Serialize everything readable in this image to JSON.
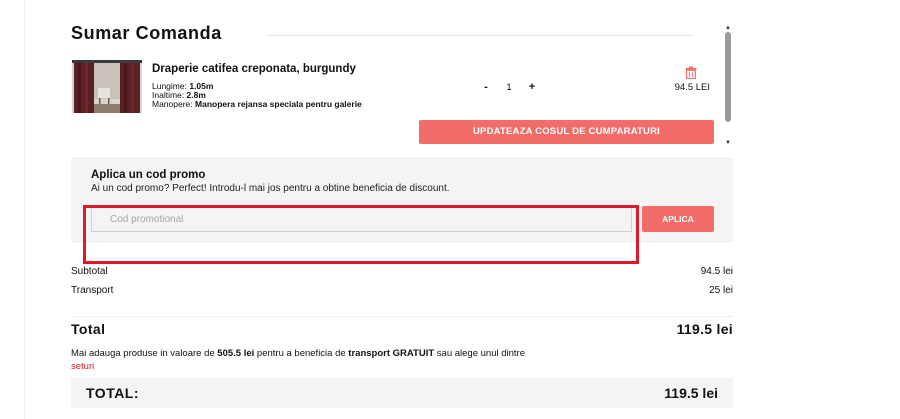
{
  "summary": {
    "title": "Sumar Comanda"
  },
  "cart_item": {
    "image_icon": "curtain-product-photo",
    "name": "Draperie catifea creponata, burgundy",
    "length_label": "Lungime:",
    "length_value": "1.05m",
    "height_label": "Inaltime:",
    "height_value": "2.8m",
    "finish_label": "Manopere:",
    "finish_value": "Manopera rejansa speciala pentru galerie",
    "qty_minus": "-",
    "qty_value": "1",
    "qty_plus": "+",
    "remove_icon": "trash-icon",
    "price": "94.5 LEI"
  },
  "update_cart_label": "UPDATEAZA COSUL DE CUMPARATURI",
  "promo": {
    "title": "Aplica un cod promo",
    "description": "Ai un cod promo? Perfect! Introdu-l mai jos pentru a obtine beneficia de discount.",
    "input_placeholder": "Cod promotional",
    "input_value": "",
    "apply_label": "APLICA"
  },
  "totals": {
    "subtotal_label": "Subtotal",
    "subtotal_value": "94.5 lei",
    "transport_label": "Transport",
    "transport_value": "25 lei",
    "total_label": "Total",
    "total_value": "119.5 lei",
    "grand_label": "TOTAL:",
    "grand_value": "119.5 lei"
  },
  "shipping_note": {
    "part1": "Mai adauga produse in valoare de ",
    "amount": "505.5 lei",
    "part2": " pentru a beneficia de ",
    "free_shipping": "transport GRATUIT",
    "part3": " sau alege unul dintre",
    "link": "seturi"
  },
  "colors": {
    "accent": "#f26d6a",
    "highlight": "#e0192a",
    "panel": "#f4f4f4"
  }
}
